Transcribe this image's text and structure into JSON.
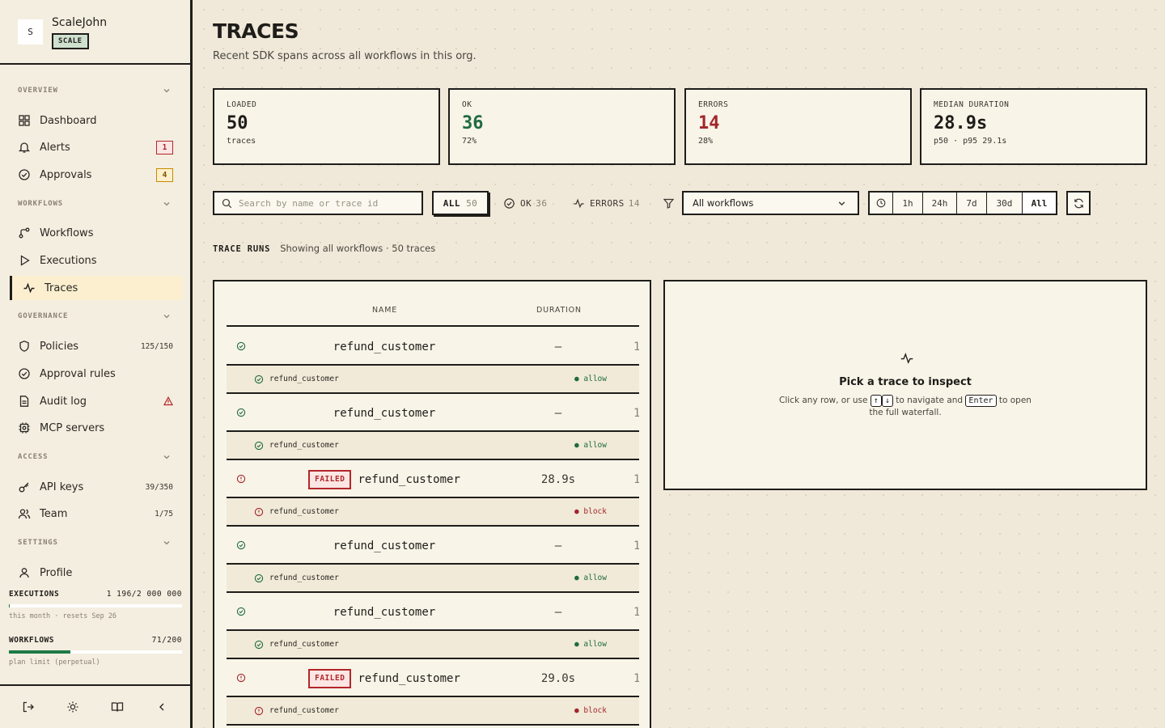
{
  "brand": {
    "avatar": "S",
    "name": "ScaleJohn",
    "plan": "SCALE"
  },
  "nav": {
    "overview": {
      "header": "OVERVIEW",
      "dashboard": "Dashboard",
      "alerts": "Alerts",
      "alerts_count": "1",
      "approvals": "Approvals",
      "approvals_count": "4"
    },
    "workflows": {
      "header": "WORKFLOWS",
      "workflows": "Workflows",
      "executions": "Executions",
      "traces": "Traces"
    },
    "governance": {
      "header": "GOVERNANCE",
      "policies": "Policies",
      "policies_meta": "125/150",
      "approval_rules": "Approval rules",
      "audit_log": "Audit log",
      "mcp_servers": "MCP servers"
    },
    "access": {
      "header": "ACCESS",
      "api_keys": "API keys",
      "api_keys_meta": "39/350",
      "team": "Team",
      "team_meta": "1/75"
    },
    "settings": {
      "header": "SETTINGS",
      "profile": "Profile"
    }
  },
  "usage": {
    "executions": {
      "label": "EXECUTIONS",
      "value": "1 196/2 000 000",
      "fraction": 0.0006,
      "sub": "this month · resets Sep 26"
    },
    "workflows": {
      "label": "WORKFLOWS",
      "value": "71/200",
      "fraction": 0.355,
      "sub": "plan limit (perpetual)"
    }
  },
  "page": {
    "title": "TRACES",
    "subtitle": "Recent SDK spans across all workflows in this org."
  },
  "stats": {
    "loaded": {
      "label": "LOADED",
      "value": "50",
      "sub": "traces"
    },
    "ok": {
      "label": "OK",
      "value": "36",
      "sub": "72%"
    },
    "errors": {
      "label": "ERRORS",
      "value": "14",
      "sub": "28%"
    },
    "median": {
      "label": "MEDIAN DURATION",
      "value": "28.9s",
      "sub": "p50 · p95 29.1s"
    }
  },
  "toolbar": {
    "search_placeholder": "Search by name or trace id",
    "all_label": "ALL",
    "all_count": "50",
    "ok_label": "OK",
    "ok_count": "36",
    "errors_label": "ERRORS",
    "errors_count": "14",
    "workflow_select": "All workflows",
    "ranges": [
      "1h",
      "24h",
      "7d",
      "30d",
      "All"
    ],
    "active_range": "All"
  },
  "runs": {
    "title": "TRACE RUNS",
    "summary": "Showing all workflows · 50 traces",
    "columns": {
      "name": "NAME",
      "duration": "DURATION"
    },
    "rows": [
      {
        "status": "ok",
        "failed_label": "",
        "name": "refund_customer",
        "duration": "—",
        "extra": "1",
        "span_name": "refund_customer",
        "decision": "allow"
      },
      {
        "status": "ok",
        "failed_label": "",
        "name": "refund_customer",
        "duration": "—",
        "extra": "1",
        "span_name": "refund_customer",
        "decision": "allow"
      },
      {
        "status": "error",
        "failed_label": "FAILED",
        "name": "refund_customer",
        "duration": "28.9s",
        "extra": "1",
        "span_name": "refund_customer",
        "decision": "block"
      },
      {
        "status": "ok",
        "failed_label": "",
        "name": "refund_customer",
        "duration": "—",
        "extra": "1",
        "span_name": "refund_customer",
        "decision": "allow"
      },
      {
        "status": "ok",
        "failed_label": "",
        "name": "refund_customer",
        "duration": "—",
        "extra": "1",
        "span_name": "refund_customer",
        "decision": "allow"
      },
      {
        "status": "error",
        "failed_label": "FAILED",
        "name": "refund_customer",
        "duration": "29.0s",
        "extra": "1",
        "span_name": "refund_customer",
        "decision": "block"
      }
    ]
  },
  "inspector": {
    "title": "Pick a trace to inspect",
    "text_before": "Click any row, or use",
    "key_up": "↑",
    "key_down": "↓",
    "text_middle": "to navigate and",
    "key_enter": "Enter",
    "text_after": "to open the full waterfall."
  },
  "colors": {
    "ink": "#1f1d1a",
    "ok": "#1f6b3f",
    "error": "#a3262b",
    "accent_bg": "#fbefcf"
  }
}
